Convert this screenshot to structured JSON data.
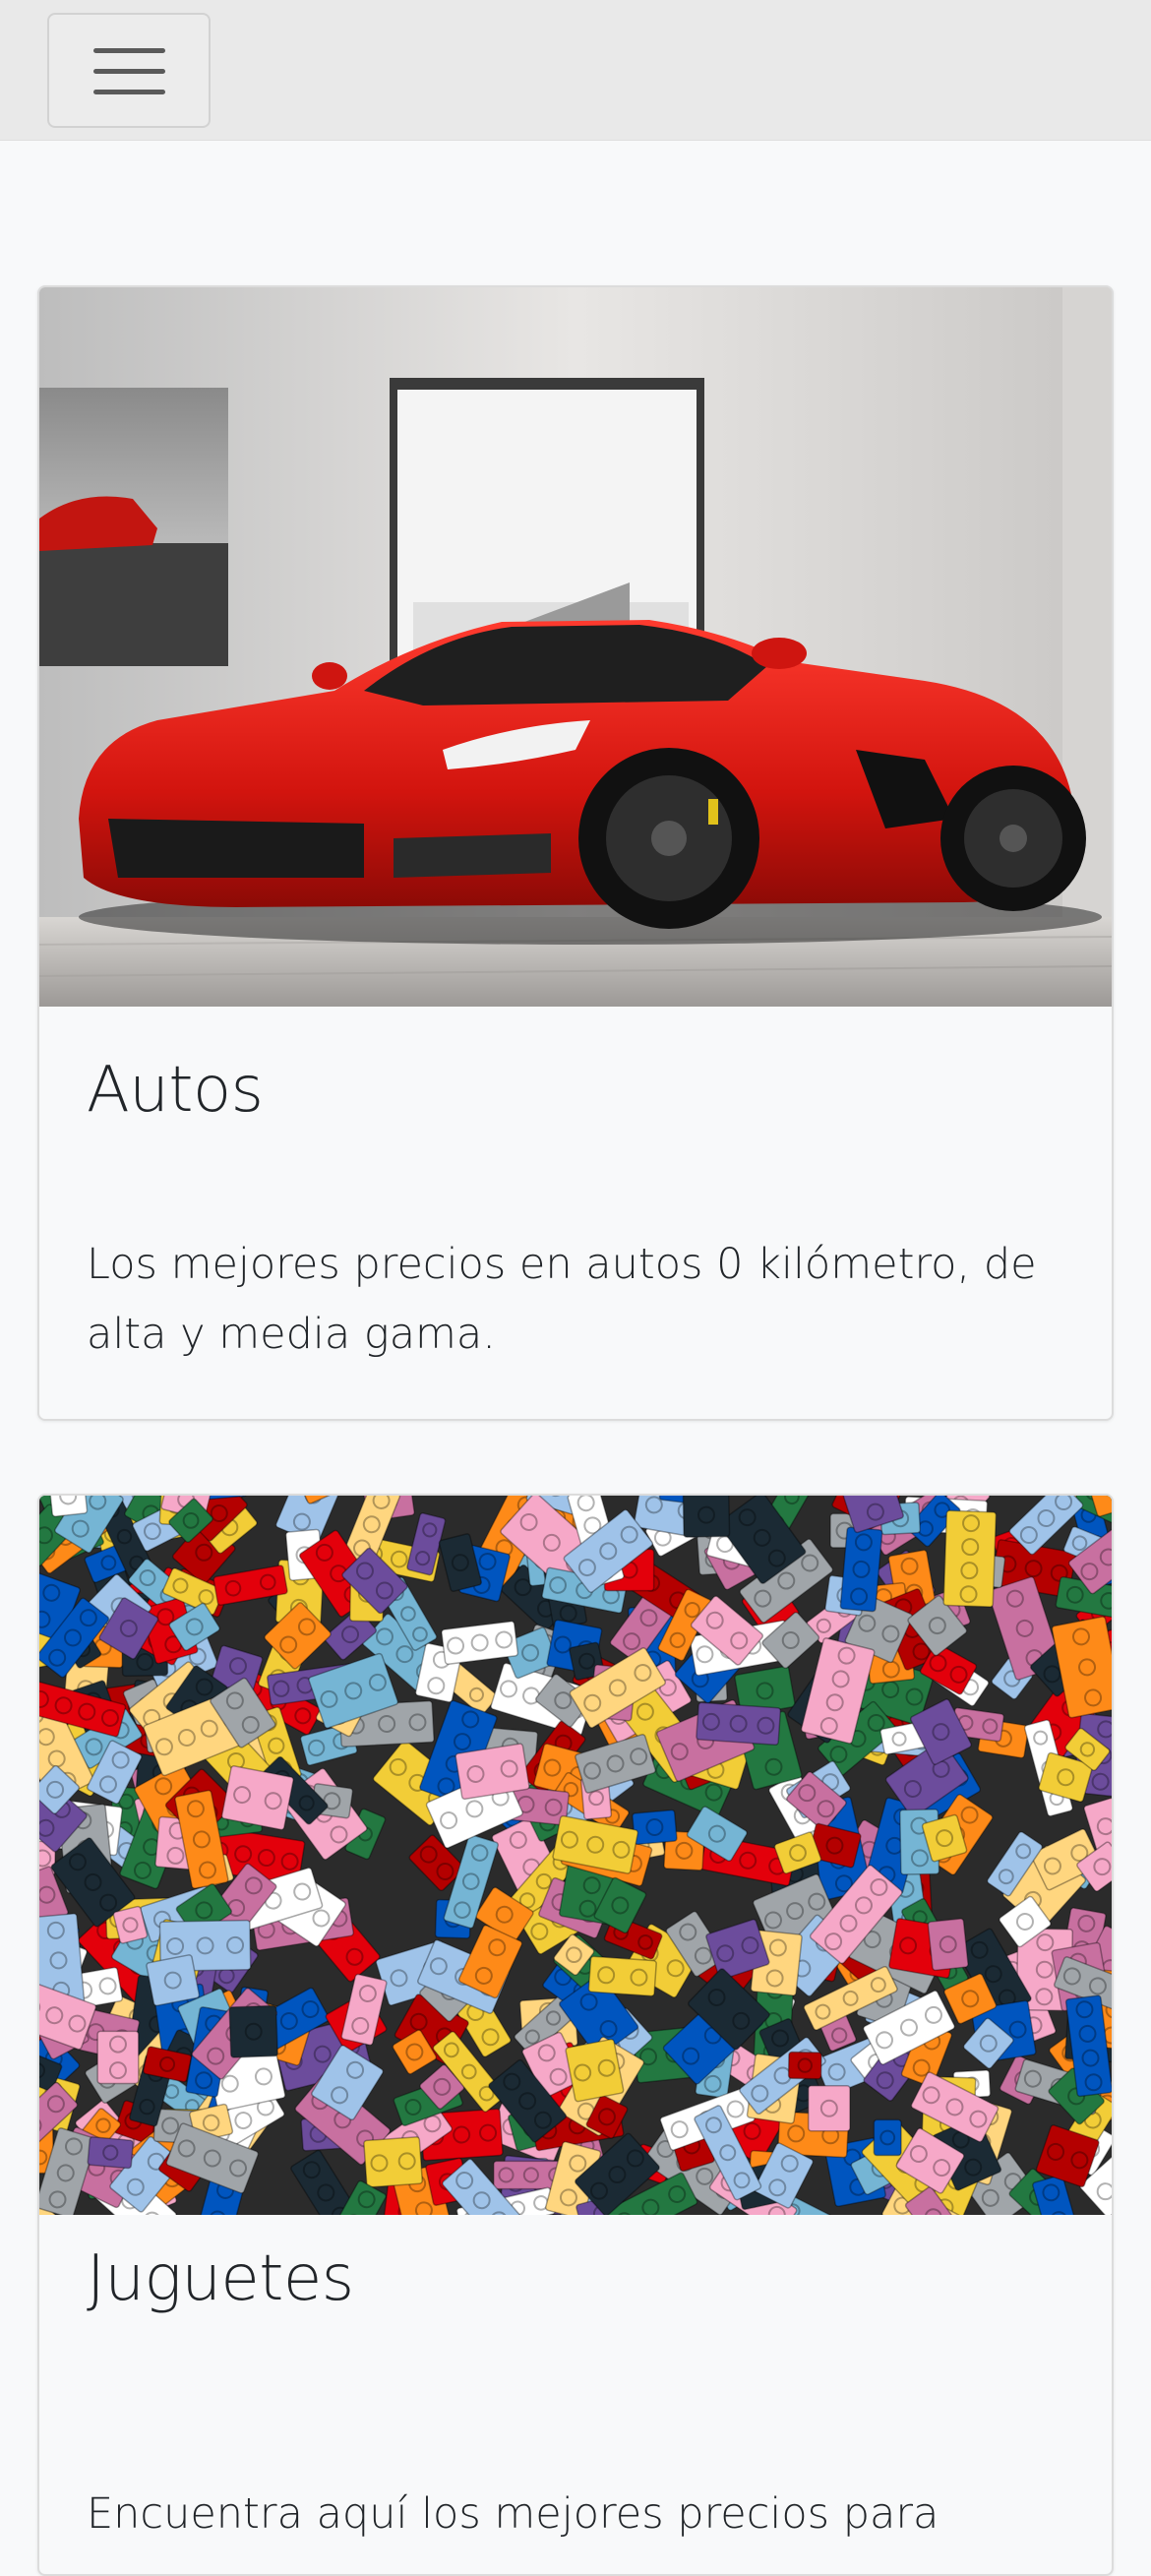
{
  "navbar": {
    "toggle_icon": "hamburger-menu-icon"
  },
  "cards": [
    {
      "image_icon": "red-sports-car-photo",
      "title": "Autos",
      "text": "Los mejores precios en autos 0 kilómetro, de alta y media gama."
    },
    {
      "image_icon": "colorful-toy-bricks-photo",
      "title": "Juguetes",
      "text": "Encuentra aquí los mejores precios para"
    }
  ],
  "colors": {
    "background": "#f8f9fa",
    "navbar": "#e9e9e9",
    "car_red": "#d61a14",
    "text": "#212529"
  }
}
